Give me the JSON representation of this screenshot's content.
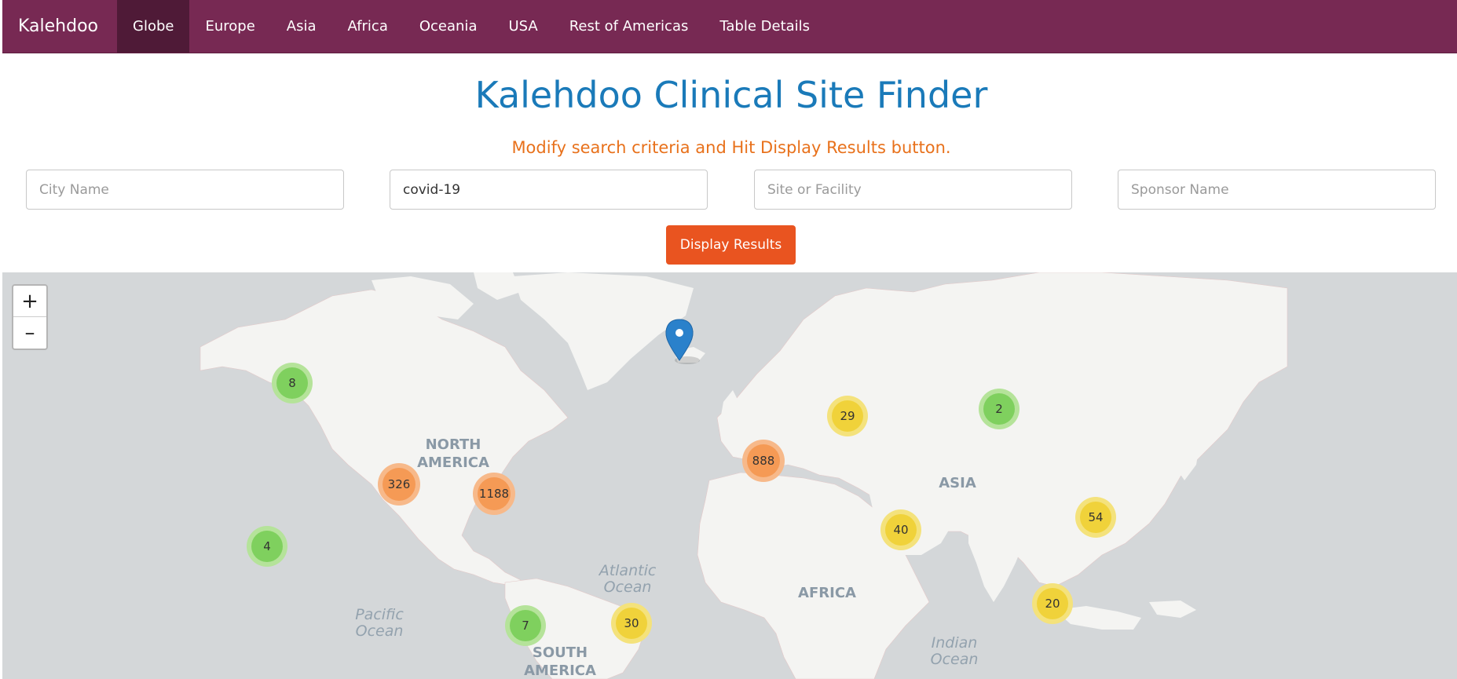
{
  "nav": {
    "brand": "Kalehdoo",
    "items": [
      {
        "label": "Globe",
        "active": true
      },
      {
        "label": "Europe"
      },
      {
        "label": "Asia"
      },
      {
        "label": "Africa"
      },
      {
        "label": "Oceania"
      },
      {
        "label": "USA"
      },
      {
        "label": "Rest of Americas"
      },
      {
        "label": "Table Details"
      }
    ]
  },
  "page": {
    "title": "Kalehdoo Clinical Site Finder",
    "subtitle": "Modify search criteria and Hit Display Results button."
  },
  "search": {
    "city": {
      "placeholder": "City Name",
      "value": ""
    },
    "condition": {
      "placeholder": "",
      "value": "covid-19"
    },
    "site": {
      "placeholder": "Site or Facility",
      "value": ""
    },
    "sponsor": {
      "placeholder": "Sponsor Name",
      "value": ""
    },
    "submit_label": "Display Results"
  },
  "map": {
    "zoom_in": "+",
    "zoom_out": "–",
    "labels": {
      "north_america_1": "NORTH",
      "north_america_2": "AMERICA",
      "south_america_1": "SOUTH",
      "south_america_2": "AMERICA",
      "asia": "ASIA",
      "africa": "AFRICA",
      "atlantic_1": "Atlantic",
      "atlantic_2": "Ocean",
      "pacific_1": "Pacific",
      "pacific_2": "Ocean",
      "indian_1": "Indian",
      "indian_2": "Ocean"
    },
    "clusters": [
      {
        "name": "alaska",
        "count": "8",
        "color": "green"
      },
      {
        "name": "western-usa",
        "count": "326",
        "color": "orange"
      },
      {
        "name": "eastern-usa",
        "count": "1188",
        "color": "orange"
      },
      {
        "name": "hawaii",
        "count": "4",
        "color": "green"
      },
      {
        "name": "south-america-west",
        "count": "7",
        "color": "green"
      },
      {
        "name": "brazil",
        "count": "30",
        "color": "yellow"
      },
      {
        "name": "europe",
        "count": "888",
        "color": "orange"
      },
      {
        "name": "russia-west",
        "count": "29",
        "color": "yellow"
      },
      {
        "name": "siberia",
        "count": "2",
        "color": "green"
      },
      {
        "name": "middle-east",
        "count": "40",
        "color": "yellow"
      },
      {
        "name": "east-asia",
        "count": "54",
        "color": "yellow"
      },
      {
        "name": "southeast-asia",
        "count": "20",
        "color": "yellow"
      }
    ],
    "colors": {
      "green_inner": "#7fd05e",
      "green_outer": "#b5e39a",
      "yellow_inner": "#f0d23a",
      "yellow_outer": "#f4e27c",
      "orange_inner": "#f59a55",
      "orange_outer": "#f7b98a",
      "marker": "#2a81cb",
      "ocean": "#d4d7d9",
      "land": "#f4f4f2"
    }
  }
}
